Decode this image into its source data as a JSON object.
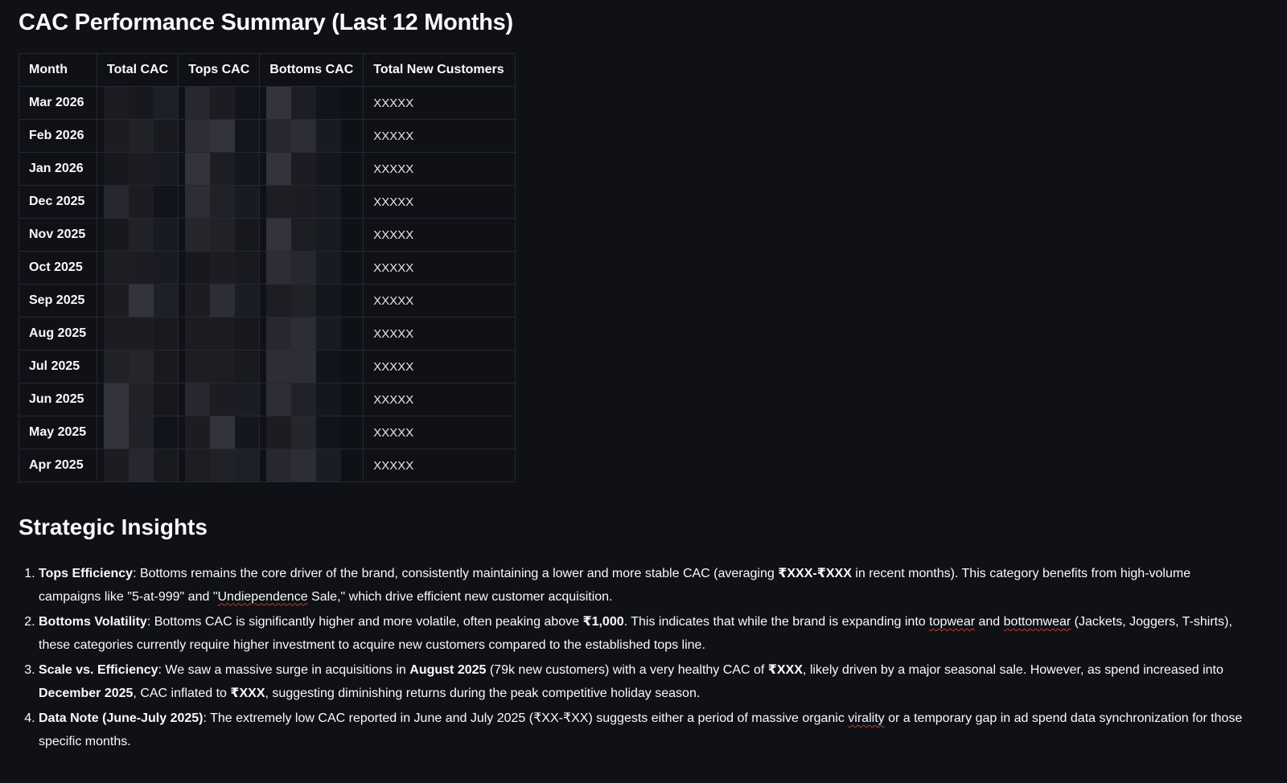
{
  "title": "CAC Performance Summary (Last 12 Months)",
  "table": {
    "headers": {
      "month": "Month",
      "total_cac": "Total CAC",
      "tops_cac": "Tops CAC",
      "bottoms_cac": "Bottoms CAC",
      "total_new_customers": "Total New Customers"
    },
    "rows": [
      {
        "month": "Mar 2026",
        "customers": "XXXXX"
      },
      {
        "month": "Feb 2026",
        "customers": "XXXXX"
      },
      {
        "month": "Jan 2026",
        "customers": "XXXXX"
      },
      {
        "month": "Dec 2025",
        "customers": "XXXXX"
      },
      {
        "month": "Nov 2025",
        "customers": "XXXXX"
      },
      {
        "month": "Oct 2025",
        "customers": "XXXXX"
      },
      {
        "month": "Sep 2025",
        "customers": "XXXXX"
      },
      {
        "month": "Aug 2025",
        "customers": "XXXXX"
      },
      {
        "month": "Jul 2025",
        "customers": "XXXXX"
      },
      {
        "month": "Jun 2025",
        "customers": "XXXXX"
      },
      {
        "month": "May 2025",
        "customers": "XXXXX"
      },
      {
        "month": "Apr 2025",
        "customers": "XXXXX"
      }
    ]
  },
  "insights": {
    "heading": "Strategic Insights",
    "items": [
      {
        "title": "Tops Efficiency",
        "p1": ": Bottoms remains the core driver of the brand, consistently maintaining a lower and more stable CAC (averaging ",
        "b1": "₹XXX-₹XXX",
        "p2": " in recent months). This category benefits from high-volume campaigns like \"5-at-999\" and \"",
        "s1": "Undiependence",
        "p3": " Sale,\" which drive efficient new customer acquisition."
      },
      {
        "title": "Bottoms Volatility",
        "p1": ": Bottoms CAC is significantly higher and more volatile, often peaking above ",
        "b1": "₹1,000",
        "p2": ". This indicates that while the brand is expanding into ",
        "s1": "topwear",
        "p3": " and ",
        "s2": "bottomwear",
        "p4": " (Jackets, Joggers, T-shirts), these categories currently require higher investment to acquire new customers compared to the established tops line."
      },
      {
        "title": "Scale vs. Efficiency",
        "p1": ": We saw a massive surge in acquisitions in ",
        "b1": "August 2025",
        "p2": " (79k new customers) with a very healthy CAC of ",
        "b2": "₹XXX",
        "p3": ", likely driven by a major seasonal sale. However, as spend increased into ",
        "b3": "December 2025",
        "p4": ", CAC inflated to ",
        "b4": "₹XXX",
        "p5": ", suggesting diminishing returns during the peak competitive holiday season."
      },
      {
        "title": "Data Note (June-July 2025)",
        "p1": ": The extremely low CAC reported in June and July 2025 (₹XX-₹XX) suggests either a period of massive organic ",
        "s1": "virality",
        "p2": " or a temporary gap in ad spend data synchronization for those specific months."
      }
    ]
  }
}
